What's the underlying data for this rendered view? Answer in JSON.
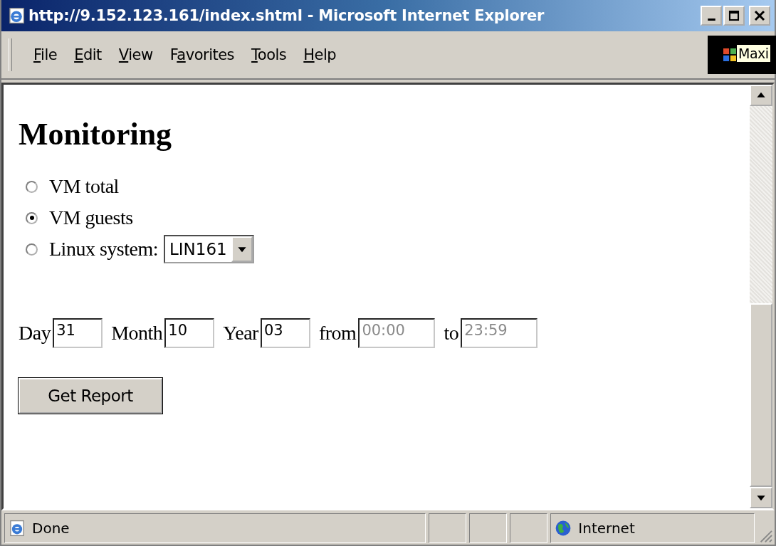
{
  "window": {
    "title": "http://9.152.123.161/index.shtml - Microsoft Internet Explorer"
  },
  "menu": [
    {
      "key": "F",
      "post": "ile"
    },
    {
      "key": "E",
      "post": "dit"
    },
    {
      "key": "V",
      "post": "iew"
    },
    {
      "pre": "F",
      "key": "a",
      "post": "vorites"
    },
    {
      "key": "T",
      "post": "ools"
    },
    {
      "key": "H",
      "post": "elp"
    }
  ],
  "tooltip": "Maxi",
  "page": {
    "heading": "Monitoring",
    "options": [
      {
        "kind": "plain",
        "label": "VM total",
        "selected": false
      },
      {
        "kind": "plain",
        "label": "VM guests",
        "selected": true
      },
      {
        "kind": "select",
        "label": "Linux system:",
        "value": "LIN161",
        "selected": false
      }
    ],
    "fields": [
      {
        "label": "Day",
        "value": "31",
        "disabled": false
      },
      {
        "label": "Month",
        "value": "10",
        "disabled": false
      },
      {
        "label": "Year",
        "value": "03",
        "disabled": false
      },
      {
        "label": "from",
        "value": "00:00",
        "disabled": true
      },
      {
        "label": "to",
        "value": "23:59",
        "disabled": true
      }
    ],
    "button": "Get Report"
  },
  "status_bar": {
    "text": "Done",
    "zone": "Internet"
  }
}
